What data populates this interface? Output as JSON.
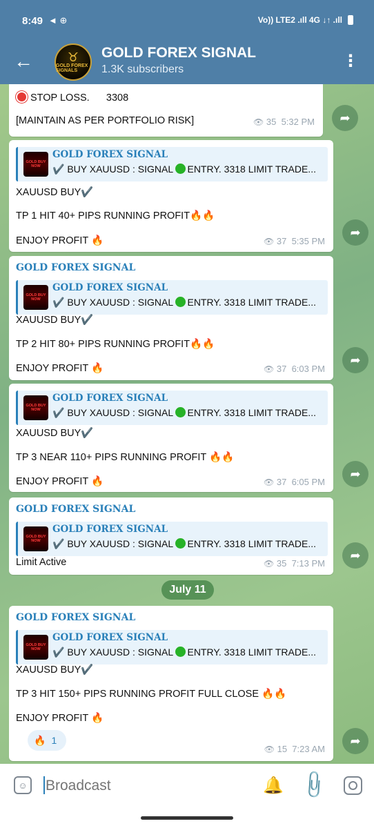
{
  "status_bar": {
    "time": "8:49",
    "left_icons": "◄ ⊕",
    "right_info": "Vo)) LTE2 .ıll 4G ↓↑ .ıll"
  },
  "header": {
    "back_icon": "←",
    "avatar_text": "GOLD FOREX SIGNALS",
    "title": "GOLD FOREX SIGNAL",
    "subscribers": "1.3K subscribers",
    "menu_icon": "⋮"
  },
  "reply_preview": {
    "thumb_text": "GOLD BUY NOW",
    "title": "GOLD FOREX SIGNAL",
    "text_a": "✔️ BUY XAUUSD : SIGNAL ",
    "text_b": "ENTRY. 3318 LIMIT TRADE..."
  },
  "messages": [
    {
      "stop_loss_label": "STOP LOSS.",
      "stop_loss_value": "3308",
      "line2": "[MAINTAIN AS PER PORTFOLIO RISK]",
      "views": "35",
      "time": "5:32 PM"
    },
    {
      "line1": "XAUUSD BUY✔️",
      "line2": "TP 1 HIT 40+ PIPS RUNNING PROFIT🔥🔥",
      "line3": "ENJOY PROFIT 🔥",
      "views": "37",
      "time": "5:35 PM"
    },
    {
      "sender": "GOLD FOREX SIGNAL",
      "line1": "XAUUSD BUY✔️",
      "line2": "TP 2 HIT 80+ PIPS RUNNING PROFIT🔥🔥",
      "line3": "ENJOY PROFIT 🔥",
      "views": "37",
      "time": "6:03 PM"
    },
    {
      "line1": "XAUUSD BUY✔️",
      "line2": "TP 3 NEAR 110+ PIPS RUNNING PROFIT 🔥🔥",
      "line3": "ENJOY PROFIT 🔥",
      "views": "37",
      "time": "6:05 PM"
    },
    {
      "sender": "GOLD FOREX SIGNAL",
      "line1": "Limit Active",
      "views": "35",
      "time": "7:13 PM"
    },
    {
      "sender": "GOLD FOREX SIGNAL",
      "line1": "XAUUSD BUY✔️",
      "line2": "TP 3 HIT 150+ PIPS RUNNING PROFIT FULL CLOSE 🔥🔥",
      "line3": "ENJOY PROFIT 🔥",
      "reaction_emoji": "🔥",
      "reaction_count": "1",
      "views": "15",
      "time": "7:23 AM"
    }
  ],
  "date_separator": "July 11",
  "icons": {
    "eye": "👁",
    "share": "➦",
    "emoji": "☺",
    "bell": "🔔",
    "attach": "📎"
  },
  "input": {
    "placeholder": "Broadcast"
  }
}
